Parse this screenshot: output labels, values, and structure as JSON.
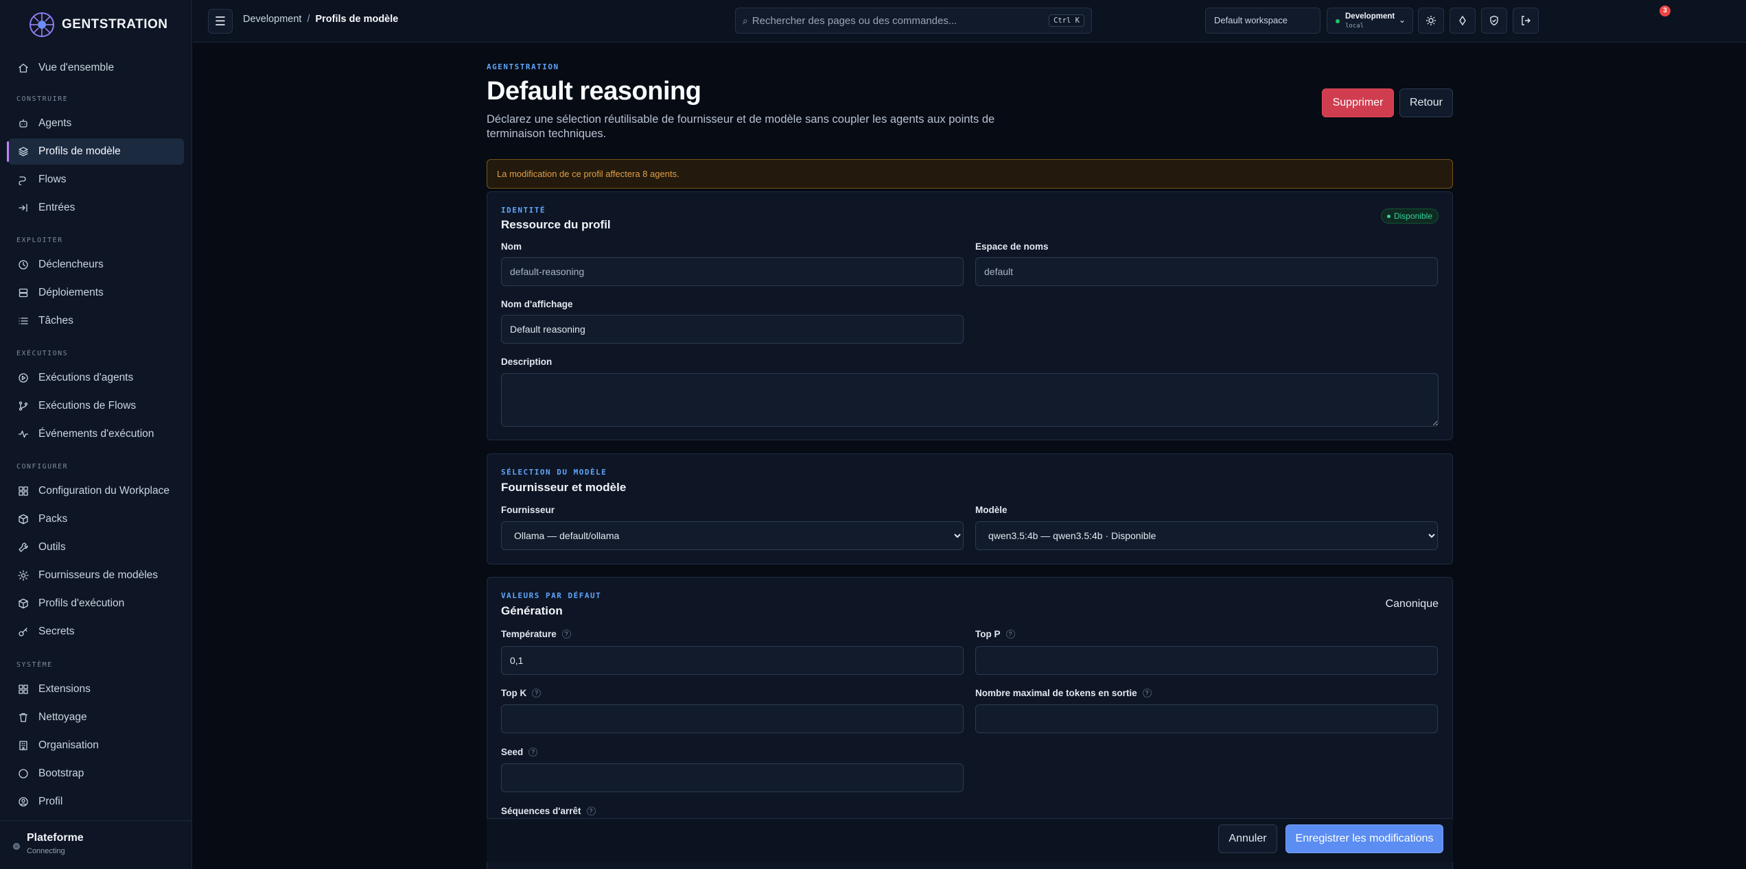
{
  "brand": {
    "name": "GENTSTRATION"
  },
  "sidebar": {
    "items_top": [
      {
        "label": "Vue d'ensemble",
        "icon": "home-icon"
      }
    ],
    "groups": [
      {
        "title": "CONSTRUIRE",
        "items": [
          {
            "label": "Agents",
            "icon": "bot-icon"
          },
          {
            "label": "Profils de modèle",
            "icon": "layers-icon",
            "active": true
          },
          {
            "label": "Flows",
            "icon": "flow-icon"
          },
          {
            "label": "Entrées",
            "icon": "enter-icon"
          }
        ]
      },
      {
        "title": "EXPLOITER",
        "items": [
          {
            "label": "Déclencheurs",
            "icon": "clock-icon"
          },
          {
            "label": "Déploiements",
            "icon": "server-icon"
          },
          {
            "label": "Tâches",
            "icon": "list-icon"
          }
        ]
      },
      {
        "title": "EXÉCUTIONS",
        "items": [
          {
            "label": "Exécutions d'agents",
            "icon": "play-circle-icon"
          },
          {
            "label": "Exécutions de Flows",
            "icon": "git-branch-icon"
          },
          {
            "label": "Événements d'exécution",
            "icon": "activity-icon"
          }
        ]
      },
      {
        "title": "CONFIGURER",
        "items": [
          {
            "label": "Configuration du Workplace",
            "icon": "grid-icon"
          },
          {
            "label": "Packs",
            "icon": "package-icon"
          },
          {
            "label": "Outils",
            "icon": "wrench-icon"
          },
          {
            "label": "Fournisseurs de modèles",
            "icon": "cog-icon"
          },
          {
            "label": "Profils d'exécution",
            "icon": "cube-icon"
          },
          {
            "label": "Secrets",
            "icon": "key-icon"
          }
        ]
      },
      {
        "title": "SYSTÈME",
        "items": [
          {
            "label": "Extensions",
            "icon": "extensions-icon"
          },
          {
            "label": "Nettoyage",
            "icon": "trash-icon"
          },
          {
            "label": "Organisation",
            "icon": "building-icon"
          },
          {
            "label": "Bootstrap",
            "icon": "circle-icon"
          },
          {
            "label": "Profil",
            "icon": "user-icon"
          }
        ]
      }
    ],
    "footer": {
      "title": "Plateforme",
      "status": "Connecting"
    }
  },
  "header": {
    "breadcrumb": [
      "Development",
      "Profils de modèle"
    ],
    "search_placeholder": "Rechercher des pages ou des commandes...",
    "search_shortcut": "Ctrl K",
    "workspace": "Default workspace",
    "env_name": "Development",
    "env_sub": "local",
    "notifications_count": "3"
  },
  "page": {
    "eyebrow": "AGENTSTRATION",
    "title": "Default reasoning",
    "description": "Déclarez une sélection réutilisable de fournisseur et de modèle sans coupler les agents aux points de terminaison techniques.",
    "delete_label": "Supprimer",
    "back_label": "Retour",
    "warning": "La modification de ce profil affectera 8 agents."
  },
  "identity": {
    "eyebrow": "IDENTITÉ",
    "title": "Ressource du profil",
    "status": "Disponible",
    "name_label": "Nom",
    "name_value": "default-reasoning",
    "namespace_label": "Espace de noms",
    "namespace_value": "default",
    "display_label": "Nom d'affichage",
    "display_value": "Default reasoning",
    "description_label": "Description",
    "description_value": ""
  },
  "model": {
    "eyebrow": "SÉLECTION DU MODÈLE",
    "title": "Fournisseur et modèle",
    "provider_label": "Fournisseur",
    "provider_value": "Ollama — default/ollama",
    "model_label": "Modèle",
    "model_value": "qwen3.5:4b — qwen3.5:4b · Disponible"
  },
  "generation": {
    "eyebrow": "VALEURS PAR DÉFAUT",
    "title": "Génération",
    "mode": "Canonique",
    "temperature_label": "Température",
    "temperature_value": "0,1",
    "top_p_label": "Top P",
    "top_p_value": "",
    "top_k_label": "Top K",
    "top_k_value": "",
    "max_tokens_label": "Nombre maximal de tokens en sortie",
    "max_tokens_value": "",
    "seed_label": "Seed",
    "seed_value": "",
    "stop_label": "Séquences d'arrêt"
  },
  "footer": {
    "cancel_label": "Annuler",
    "save_label": "Enregistrer les modifications"
  },
  "colors": {
    "accent": "#5b8df2",
    "danger": "#d03d4f",
    "success": "#34d399",
    "active_bar": "#c084fc"
  }
}
